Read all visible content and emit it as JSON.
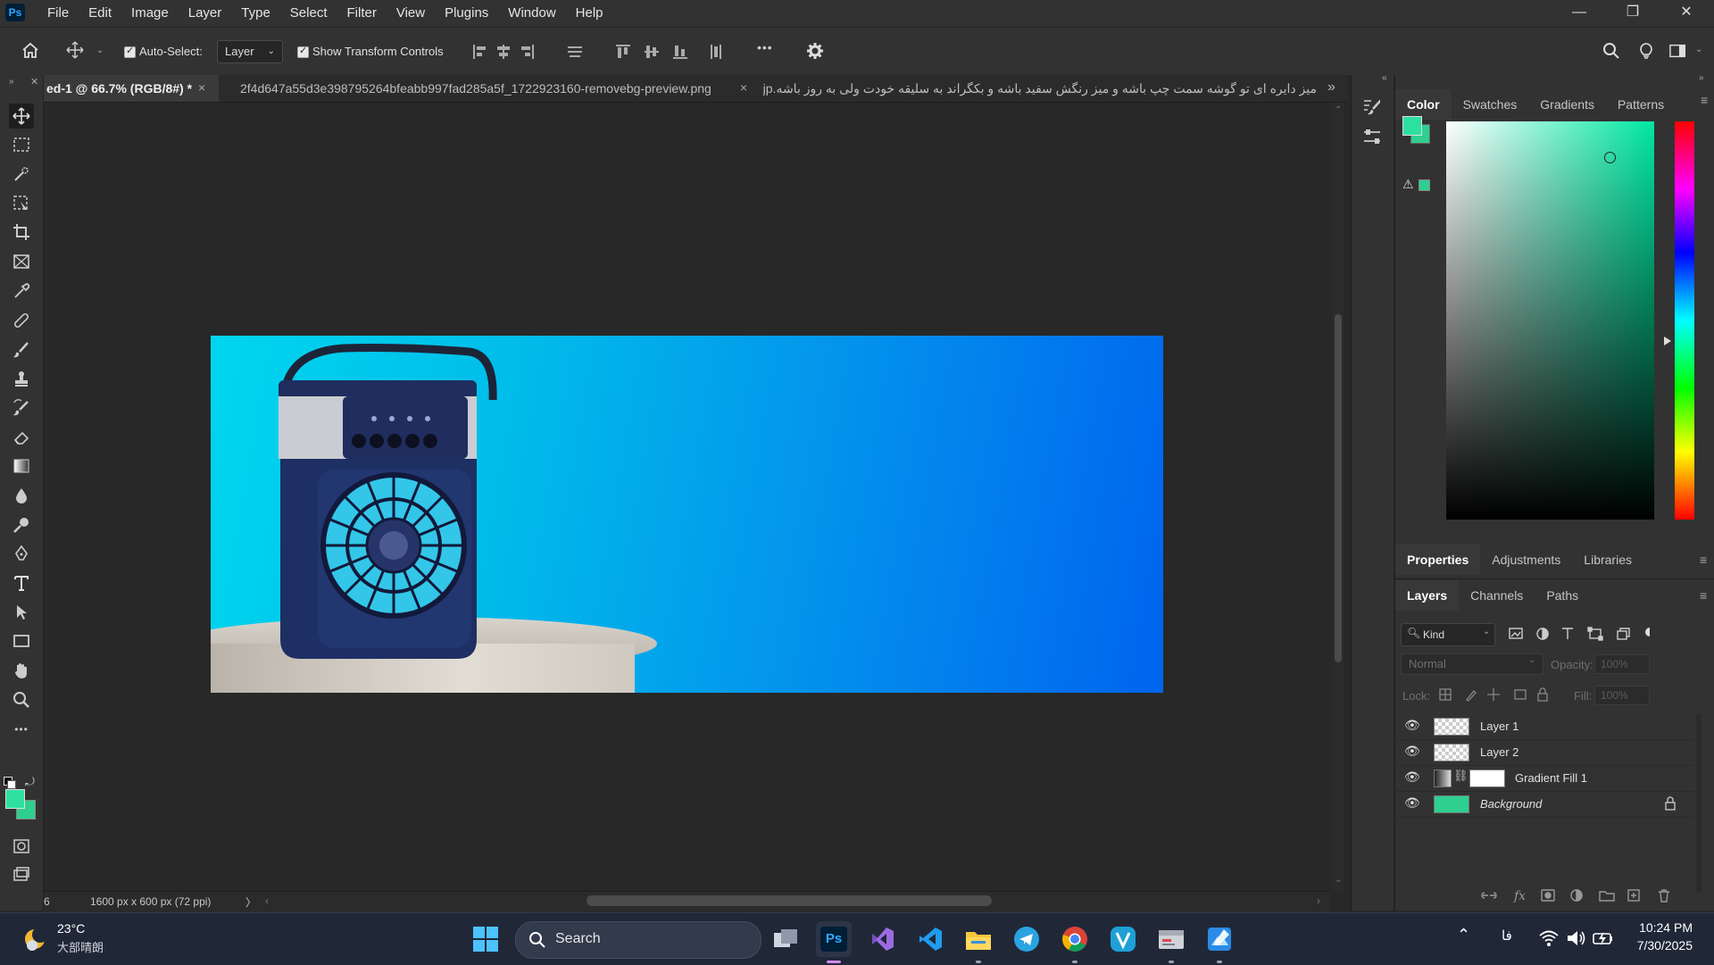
{
  "app": {
    "logo_text": "Ps"
  },
  "menu": [
    "File",
    "Edit",
    "Image",
    "Layer",
    "Type",
    "Select",
    "Filter",
    "View",
    "Plugins",
    "Window",
    "Help"
  ],
  "window_controls": {
    "minimize": "—",
    "restore": "❐",
    "close": "✕"
  },
  "options_bar": {
    "auto_select_label": "Auto-Select:",
    "auto_select_value": "Layer",
    "transform_label": "Show Transform Controls",
    "more_label": "•••"
  },
  "tabs": [
    {
      "label": "ed-1 @ 66.7% (RGB/8#) *",
      "close": "×"
    },
    {
      "label": "2f4d647a55d3e398795264bfeabb997fad285a5f_1722923160-removebg-preview.png",
      "close": "×"
    },
    {
      "label": "میز دایره ای تو گوشه سمت چپ باشه و میز رنگش سفید باشه و بکگراند به سلیقه خودت ولی به روز باشه.jp"
    }
  ],
  "status_bar": {
    "zoom": "6",
    "doc_info": "1600 px x 600 px (72 ppi)",
    "arrow": "〉"
  },
  "color_panel": {
    "tabs": [
      "Color",
      "Swatches",
      "Gradients",
      "Patterns"
    ],
    "foreground": "#2ee0a0",
    "background": "#2ecf8f"
  },
  "properties_tabs": [
    "Properties",
    "Adjustments",
    "Libraries"
  ],
  "layers_panel": {
    "tabs": [
      "Layers",
      "Channels",
      "Paths"
    ],
    "filter_kind": "Kind",
    "blend_mode": "Normal",
    "opacity_label": "Opacity:",
    "opacity_value": "100%",
    "lock_label": "Lock:",
    "fill_label": "Fill:",
    "fill_value": "100%",
    "layers": [
      {
        "name": "Layer 1"
      },
      {
        "name": "Layer 2"
      },
      {
        "name": "Gradient Fill 1"
      },
      {
        "name": "Background"
      }
    ]
  },
  "taskbar": {
    "weather_temp": "23°C",
    "weather_desc": "大部晴朗",
    "search_label": "Search",
    "lang": "فا",
    "time": "10:24 PM",
    "date": "7/30/2025"
  }
}
